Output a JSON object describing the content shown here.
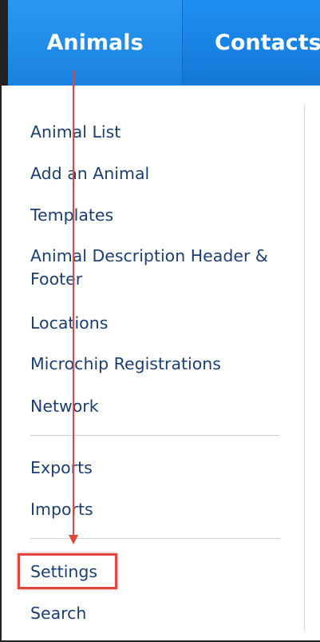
{
  "nav": {
    "tabs": [
      {
        "label": "Animals",
        "active": true
      },
      {
        "label": "Contacts",
        "active": false
      }
    ]
  },
  "menu": {
    "group1": [
      "Animal List",
      "Add an Animal",
      "Templates",
      "Animal Description Header & Footer",
      "Locations",
      "Microchip Registrations",
      "Network"
    ],
    "group2": [
      "Exports",
      "Imports"
    ],
    "group3": [
      "Settings",
      "Search"
    ]
  },
  "annotation": {
    "highlight_target": "Settings",
    "highlight_color": "#e2473f"
  },
  "colors": {
    "nav_bg": "#1a82e0",
    "menu_text": "#1b3f73"
  }
}
